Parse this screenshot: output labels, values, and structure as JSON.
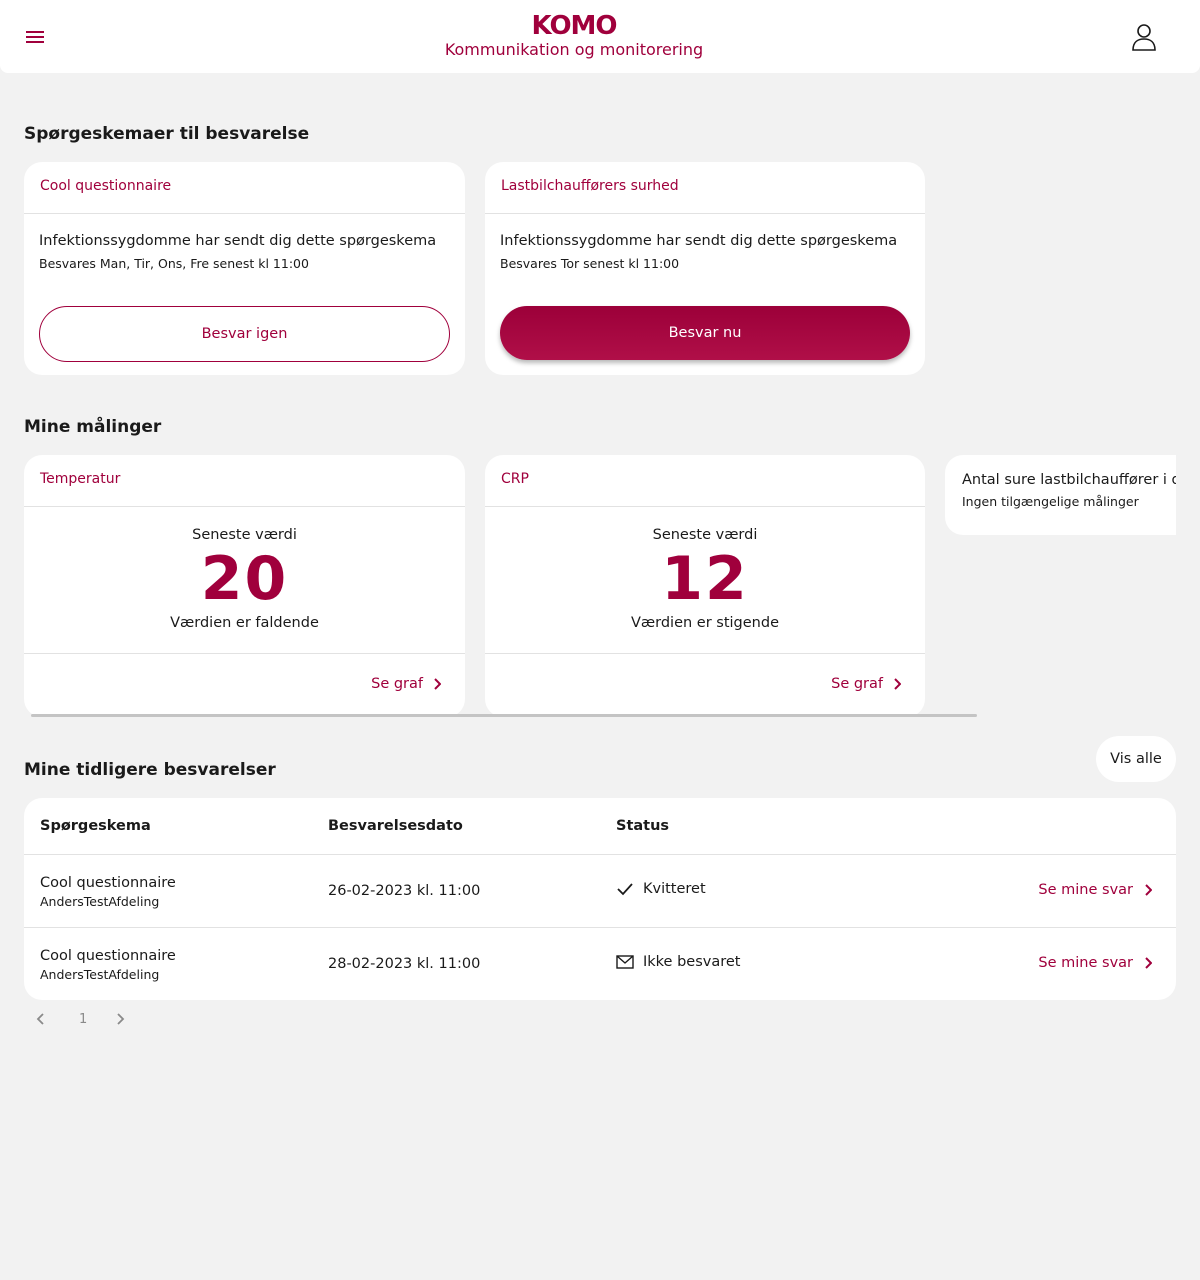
{
  "header": {
    "logo": "KOMO",
    "subtitle": "Kommunikation og monitorering",
    "menu_icon": "hamburger-menu-icon",
    "user_icon": "user-icon"
  },
  "questionnaires": {
    "title": "Spørgeskemaer til besvarelse",
    "items": [
      {
        "name": "Cool questionnaire",
        "sender": "Infektionssygdomme har sendt dig dette spørgeskema",
        "due": "Besvares Man, Tir, Ons, Fre senest kl 11:00",
        "button": "Besvar igen"
      },
      {
        "name": "Lastbilchaufførers surhed",
        "sender": "Infektionssygdomme har sendt dig dette spørgeskema",
        "due": "Besvares Tor senest kl 11:00",
        "button": "Besvar nu"
      }
    ]
  },
  "measurements": {
    "title": "Mine målinger",
    "items": [
      {
        "name": "Temperatur",
        "latest_label": "Seneste værdi",
        "value": "20",
        "trend": "Værdien er faldende",
        "link": "Se graf"
      },
      {
        "name": "CRP",
        "latest_label": "Seneste værdi",
        "value": "12",
        "trend": "Værdien er stigende",
        "link": "Se graf"
      },
      {
        "name": "Antal sure lastbilchauffører i dag",
        "empty": "Ingen tilgængelige målinger"
      }
    ]
  },
  "history": {
    "title": "Mine tidligere besvarelser",
    "show_all": "Vis alle",
    "columns": [
      "Spørgeskema",
      "Besvarelsesdato",
      "Status"
    ],
    "rows": [
      {
        "name": "Cool questionnaire",
        "department": "AndersTestAfdeling",
        "date": "26-02-2023 kl. 11:00",
        "status": "Kvitteret",
        "status_icon": "checkmark-icon",
        "link": "Se mine svar"
      },
      {
        "name": "Cool questionnaire",
        "department": "AndersTestAfdeling",
        "date": "28-02-2023 kl. 11:00",
        "status": "Ikke besvaret",
        "status_icon": "envelope-icon",
        "link": "Se mine svar"
      }
    ]
  },
  "pagination": {
    "current_page": "1"
  },
  "colors": {
    "accent": "#a0003c",
    "background": "#f2f2f2"
  }
}
